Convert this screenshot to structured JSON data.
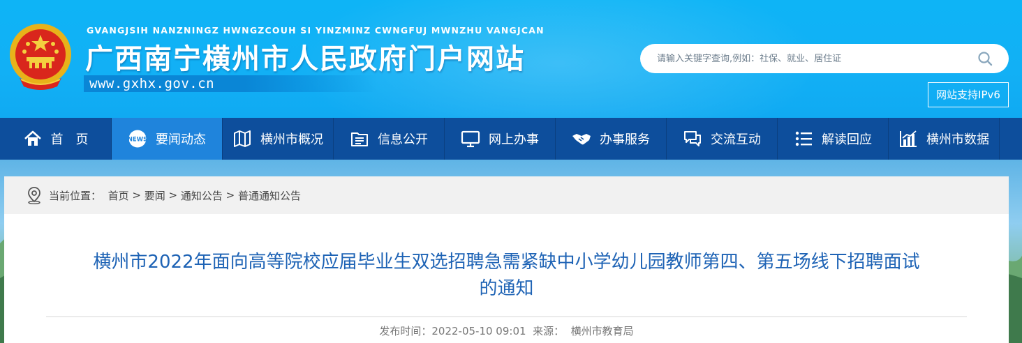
{
  "header": {
    "pinyin": "GVANGJSIH NANZNINGZ HWNGZCOUH SI YINZMINZ CWNGFUJ MWNZHU VANGJCAN",
    "title": "广西南宁横州市人民政府门户网站",
    "url": "www.gxhx.gov.cn",
    "search": {
      "placeholder": "请输入关键字查询,例如：社保、就业、居住证",
      "icon": "search-icon"
    },
    "ipv6_label": "网站支持IPv6"
  },
  "nav": {
    "items": [
      {
        "label": "首　页",
        "icon": "home-icon"
      },
      {
        "label": "要闻动态",
        "icon": "news-icon",
        "active": true
      },
      {
        "label": "横州市概况",
        "icon": "map-icon"
      },
      {
        "label": "信息公开",
        "icon": "folder-list-icon"
      },
      {
        "label": "网上办事",
        "icon": "monitor-icon"
      },
      {
        "label": "办事服务",
        "icon": "handshake-icon"
      },
      {
        "label": "交流互动",
        "icon": "chat-icon"
      },
      {
        "label": "解读回应",
        "icon": "list-icon"
      },
      {
        "label": "横州市数据",
        "icon": "bar-chart-icon"
      }
    ]
  },
  "breadcrumb": {
    "prefix": "当前位置：",
    "items": [
      "首页",
      "要闻",
      "通知公告",
      "普通通知公告"
    ],
    "separator": " > "
  },
  "article": {
    "title_line1": "横州市2022年面向高等院校应届毕业生双选招聘急需紧缺中小学幼儿园教师第四、第五场线下招聘面试",
    "title_line2": "的通知",
    "publish_label": "发布时间：",
    "publish_time": "2022-05-10 09:01",
    "source_label": "来源：",
    "source": "横州市教育局"
  },
  "colors": {
    "header_bg": "#12b0f5",
    "nav_bg": "#0d4e9c",
    "nav_active": "#1f84dc",
    "title_blue": "#1e63b5"
  }
}
